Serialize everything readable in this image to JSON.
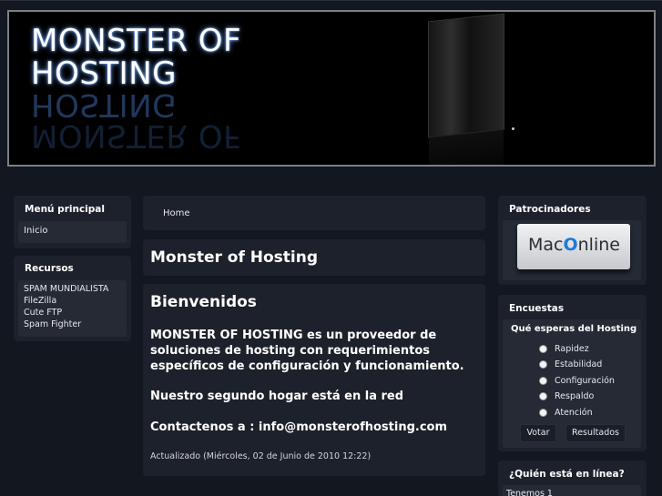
{
  "header": {
    "logo_line1": "MONSTER OF",
    "logo_line2": "HOSTING"
  },
  "left_sidebar": {
    "main_menu": {
      "title": "Menú principal",
      "items": [
        "Inicio"
      ]
    },
    "resources": {
      "title": "Recursos",
      "items": [
        "SPAM MUNDIALISTA",
        "FileZilla",
        "Cute FTP",
        "Spam Fighter"
      ]
    }
  },
  "main": {
    "breadcrumb": "Home",
    "page_title": "Monster of Hosting",
    "article": {
      "heading": "Bienvenidos",
      "paragraph1": "MONSTER OF HOSTING es un proveedor de soluciones de hosting con requerimientos específicos de configuración y funcionamiento.",
      "paragraph2": "Nuestro segundo hogar está en la red",
      "paragraph3": "Contactenos a : info@monsterofhosting.com",
      "updated": "Actualizado (Miércoles, 02 de Junio de 2010 12:22)"
    }
  },
  "right_sidebar": {
    "sponsors": {
      "title": "Patrocinadores",
      "banner_prefix": "Mac",
      "banner_o": "O",
      "banner_suffix": "nline"
    },
    "polls": {
      "title": "Encuestas",
      "question": "Qué esperas del Hosting",
      "options": [
        "Rapidez",
        "Estabilidad",
        "Configuración",
        "Respaldo",
        "Atención"
      ],
      "vote_label": "Votar",
      "results_label": "Resultados"
    },
    "online": {
      "title": "¿Quién está en línea?",
      "count_text": "Tenemos 1"
    }
  }
}
